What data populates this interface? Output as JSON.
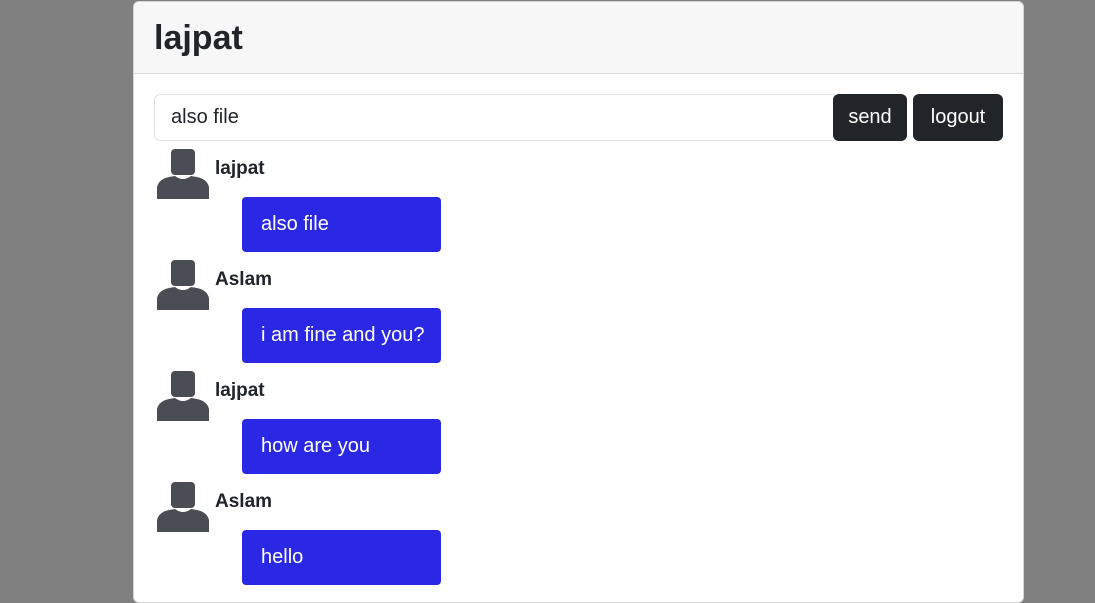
{
  "header": {
    "title": "lajpat"
  },
  "composer": {
    "input_value": "also file",
    "send_label": "send",
    "logout_label": "logout"
  },
  "colors": {
    "background": "#808080",
    "bubble": "#2b28e5",
    "button": "#212529",
    "avatar": "#4a4e54"
  },
  "messages": [
    {
      "sender": "lajpat",
      "text": "also file",
      "avatar_icon": "user-silhouette-icon"
    },
    {
      "sender": "Aslam",
      "text": "i am fine and you?",
      "avatar_icon": "user-silhouette-icon"
    },
    {
      "sender": "lajpat",
      "text": "how are you",
      "avatar_icon": "user-silhouette-icon"
    },
    {
      "sender": "Aslam",
      "text": "hello",
      "avatar_icon": "user-silhouette-icon"
    }
  ]
}
